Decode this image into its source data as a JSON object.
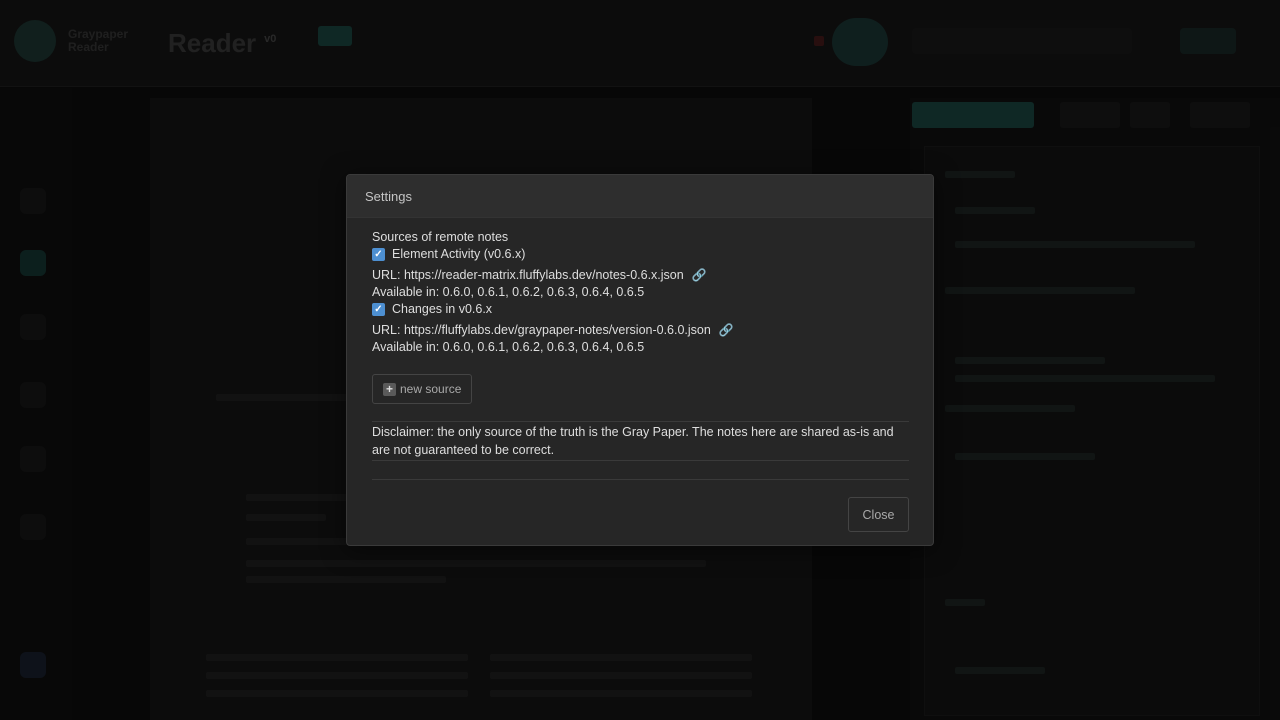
{
  "background": {
    "logo_text": "Graypaper\nReader",
    "app_title": "Reader",
    "app_version": "v0",
    "topbar_items": [
      "",
      ""
    ]
  },
  "modal": {
    "title": "Settings",
    "section_title": "Sources of remote notes",
    "sources": [
      {
        "name": "Element Activity (v0.6.x)",
        "checked": true,
        "url_text": "URL: https://reader-matrix.fluffylabs.dev/notes-0.6.x.json",
        "available_text": "Available in: 0.6.0, 0.6.1, 0.6.2, 0.6.3, 0.6.4, 0.6.5",
        "link_icon": "link-icon"
      },
      {
        "name": "Changes in v0.6.x",
        "checked": true,
        "url_text": "URL: https://fluffylabs.dev/graypaper-notes/version-0.6.0.json",
        "available_text": "Available in: 0.6.0, 0.6.1, 0.6.2, 0.6.3, 0.6.4, 0.6.5",
        "link_icon": "link-icon"
      }
    ],
    "new_source_label": "new source",
    "disclaimer": "Disclaimer: the only source of the truth is the Gray Paper. The notes here are shared as-is and are not guaranteed to be correct.",
    "close_label": "Close"
  },
  "colors": {
    "checkbox": "#4d8fd1",
    "accent": "#1d4a44",
    "modal_bg": "#262626"
  }
}
